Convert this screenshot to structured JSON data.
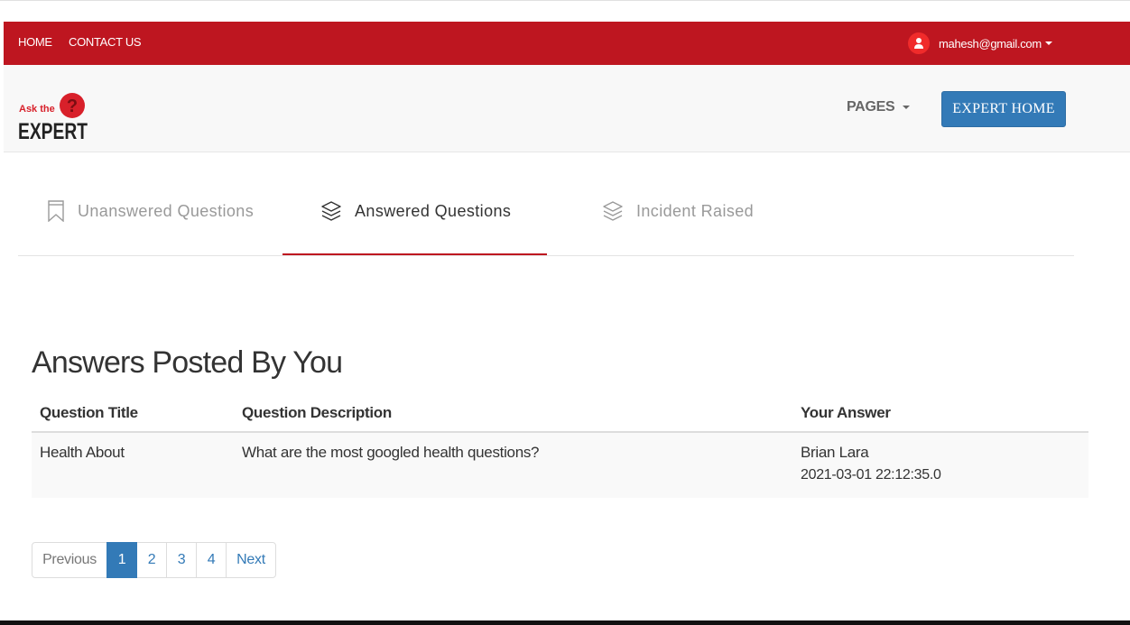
{
  "topbar": {
    "home": "HOME",
    "contact": "CONTACT US",
    "user_email": "mahesh@gmail.com"
  },
  "header": {
    "logo_line1": "Ask the",
    "logo_line2": "EXPERT",
    "pages_label": "PAGES",
    "expert_home_label": "EXPERT HOME"
  },
  "tabs": [
    {
      "label": "Unanswered Questions",
      "icon": "bookmark-icon",
      "active": false
    },
    {
      "label": "Answered Questions",
      "icon": "layers-icon",
      "active": true
    },
    {
      "label": "Incident Raised",
      "icon": "layers-icon",
      "active": false
    }
  ],
  "section": {
    "title": "Answers Posted By You"
  },
  "table": {
    "headers": [
      "Question Title",
      "Question Description",
      "Your Answer"
    ],
    "rows": [
      {
        "title": "Health About",
        "description": "What are the most googled health questions?",
        "answer": "Brian Lara",
        "timestamp": "2021-03-01 22:12:35.0"
      }
    ]
  },
  "pagination": {
    "previous": "Previous",
    "pages": [
      "1",
      "2",
      "3",
      "4"
    ],
    "current": "1",
    "next": "Next"
  },
  "colors": {
    "brand_red": "#be1620",
    "primary_blue": "#337ab7"
  }
}
